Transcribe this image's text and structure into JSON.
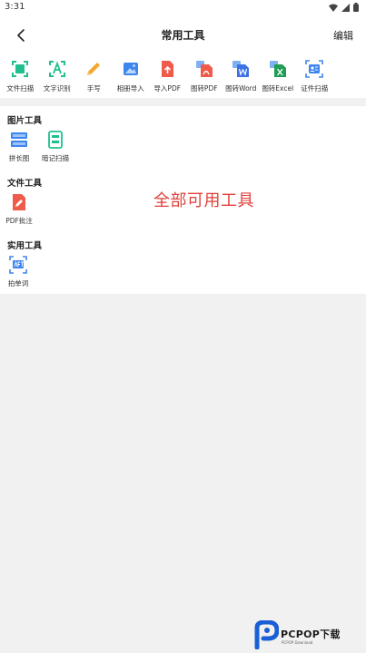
{
  "status_bar": {
    "time": "3:31"
  },
  "header": {
    "title": "常用工具",
    "edit_label": "编辑"
  },
  "quick_tools": [
    {
      "label": "文件扫描",
      "icon": "scan-frame-icon",
      "color": "#1fc08e"
    },
    {
      "label": "文字识别",
      "icon": "text-recognition-icon",
      "color": "#1fc08e"
    },
    {
      "label": "手写",
      "icon": "pencil-icon",
      "color": "#f4a72c"
    },
    {
      "label": "相册导入",
      "icon": "album-icon",
      "color": "#3e86ef"
    },
    {
      "label": "导入PDF",
      "icon": "import-pdf-icon",
      "color": "#ef5a4b"
    },
    {
      "label": "图转PDF",
      "icon": "image-to-pdf-icon",
      "color": "#ef5a4b"
    },
    {
      "label": "图转Word",
      "icon": "image-to-word-icon",
      "color": "#3e72e4"
    },
    {
      "label": "图转Excel",
      "icon": "image-to-excel-icon",
      "color": "#1f9d55"
    },
    {
      "label": "证件扫描",
      "icon": "id-card-icon",
      "color": "#3e86ef"
    }
  ],
  "sections": [
    {
      "title": "图片工具",
      "tools": [
        {
          "label": "拼长图",
          "icon": "long-image-icon"
        },
        {
          "label": "暗记扫描",
          "icon": "memo-scan-icon"
        }
      ]
    },
    {
      "title": "文件工具",
      "tools": [
        {
          "label": "PDF批注",
          "icon": "pdf-annotate-icon"
        }
      ]
    },
    {
      "title": "实用工具",
      "tools": [
        {
          "label": "拍单词",
          "icon": "word-capture-icon"
        }
      ]
    }
  ],
  "overlay_caption": "全部可用工具",
  "watermark": {
    "brand": "PCPOP下载",
    "sub": "PCPOP Download"
  }
}
